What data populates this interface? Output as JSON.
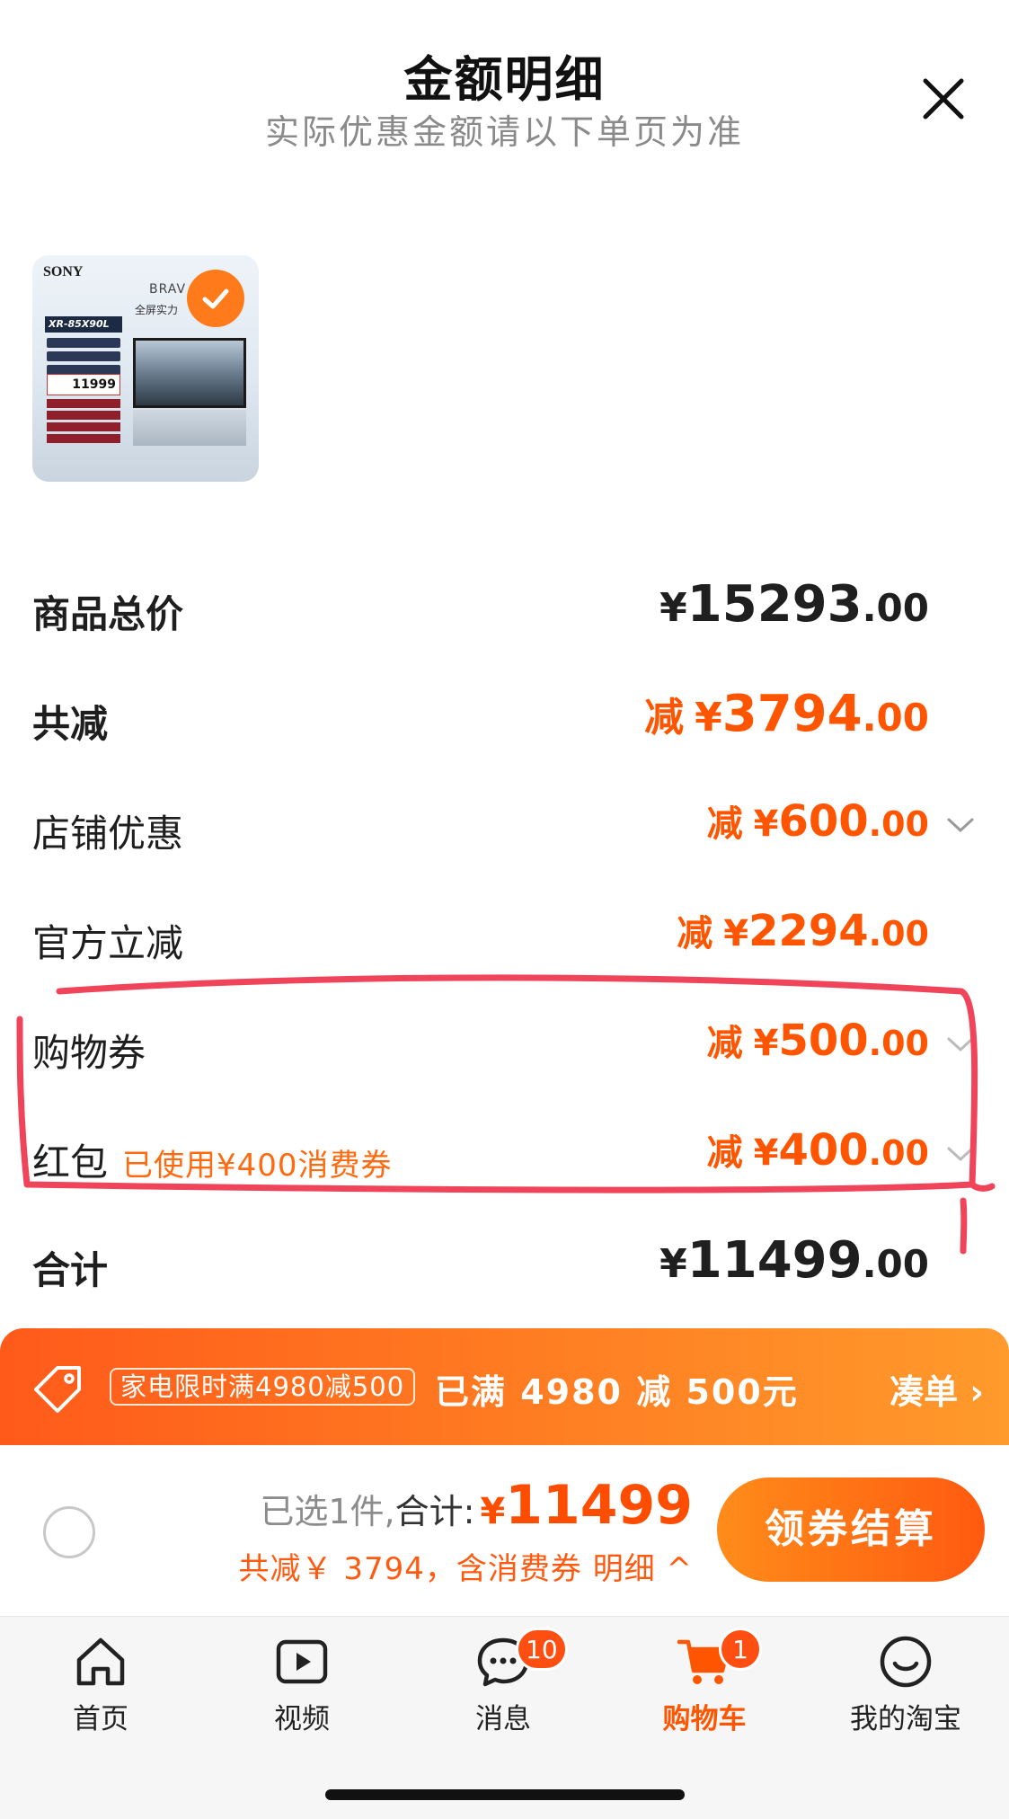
{
  "header": {
    "title": "金额明细",
    "subtitle": "实际优惠金额请以下单页为准"
  },
  "product": {
    "brand": "SONY",
    "series": "BRAV",
    "slogan": "全屏实力",
    "model": "XR-85X90L",
    "price": "11999"
  },
  "rows": {
    "total_price": {
      "label": "商品总价",
      "yen": "¥",
      "int": "15293",
      "dec": ".00"
    },
    "total_discount": {
      "label": "共减",
      "prefix": "减",
      "yen": "¥",
      "int": "3794",
      "dec": ".00"
    },
    "store_discount": {
      "label": "店铺优惠",
      "prefix": "减",
      "yen": "¥",
      "int": "600",
      "dec": ".00"
    },
    "official_discount": {
      "label": "官方立减",
      "prefix": "减",
      "yen": "¥",
      "int": "2294",
      "dec": ".00"
    },
    "shopping_voucher": {
      "label": "购物券",
      "prefix": "减",
      "yen": "¥",
      "int": "500",
      "dec": ".00"
    },
    "red_packet": {
      "label": "红包",
      "note": "已使用¥400消费券",
      "prefix": "减",
      "yen": "¥",
      "int": "400",
      "dec": ".00"
    },
    "grand_total": {
      "label": "合计",
      "yen": "¥",
      "int": "11499",
      "dec": ".00"
    }
  },
  "promo": {
    "chip": "家电限时满4980减500",
    "status": "已满 4980 减 500元",
    "action": "凑单 ›"
  },
  "checkout": {
    "selected": "已选1件,",
    "total_label": "合计:",
    "yen": "¥",
    "amount": "11499",
    "savings": "共减￥ 3794，含消费券  明细 ^",
    "pay_button": "领券结算"
  },
  "tabbar": {
    "items": [
      {
        "label": "首页",
        "icon": "home-icon"
      },
      {
        "label": "视频",
        "icon": "video-play-icon"
      },
      {
        "label": "消息",
        "icon": "message-icon",
        "badge": "10"
      },
      {
        "label": "购物车",
        "icon": "cart-icon",
        "badge": "1"
      },
      {
        "label": "我的淘宝",
        "icon": "smile-face-icon"
      }
    ]
  },
  "colors": {
    "accent_orange": "#ff5500",
    "annotation_red": "#f0445a",
    "promo_gradient_start": "#ff5a1a"
  }
}
